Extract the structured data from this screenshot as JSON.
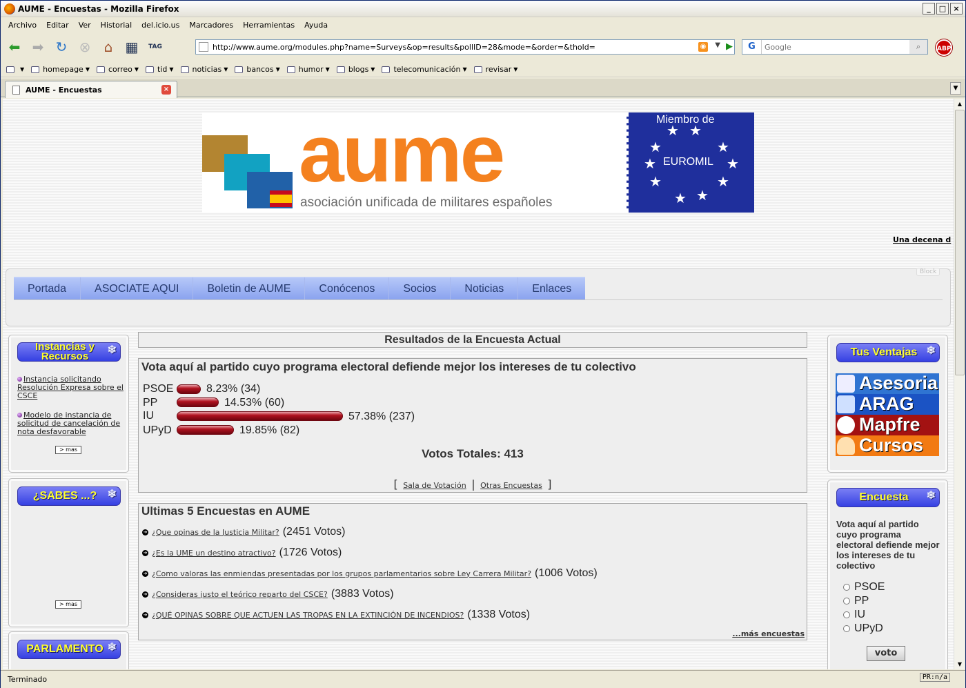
{
  "window": {
    "title": "AUME - Encuestas - Mozilla Firefox"
  },
  "menu": [
    "Archivo",
    "Editar",
    "Ver",
    "Historial",
    "del.icio.us",
    "Marcadores",
    "Herramientas",
    "Ayuda"
  ],
  "toolbar": {
    "url": "http://www.aume.org/modules.php?name=Surveys&op=results&pollID=28&mode=&order=&thold=",
    "search_placeholder": "Google",
    "tag_label": "TAG",
    "abp_label": "ABP"
  },
  "bookmarks": [
    "homepage",
    "correo",
    "tid",
    "noticias",
    "bancos",
    "humor",
    "blogs",
    "telecomunicación",
    "revisar"
  ],
  "tab": {
    "title": "AUME - Encuestas"
  },
  "status": {
    "text": "Terminado",
    "right": "PR:n/a"
  },
  "banner": {
    "word": "aume",
    "subtitle": "asociación unificada de militares españoles",
    "member": "Miembro de",
    "euromil": "EUROMIL",
    "marquee": "Una decena d"
  },
  "nav": {
    "block_tag": "Block",
    "items": [
      "Portada",
      "ASOCIATE AQUI",
      "Boletin de AUME",
      "Conócenos",
      "Socios",
      "Noticias",
      "Enlaces"
    ]
  },
  "left": {
    "box1": {
      "title": "Instancias y Recursos",
      "links": [
        "Instancia solicitando Resolución Expresa sobre el CSCE",
        "Modelo de instancia de solicitud de cancelación de nota desfavorable"
      ],
      "more": "> mas"
    },
    "box2": {
      "title": "¿SABES ...?",
      "more": "> mas"
    },
    "box3": {
      "title": "PARLAMENTO"
    }
  },
  "center": {
    "header": "Resultados de la Encuesta Actual",
    "question": "Vota aquí al partido cuyo programa electoral defiende mejor los intereses de tu colectivo",
    "results": [
      {
        "party": "PSOE",
        "text": "8.23% (34)"
      },
      {
        "party": "PP",
        "text": "14.53% (60)"
      },
      {
        "party": "IU",
        "text": "57.38% (237)"
      },
      {
        "party": "UPyD",
        "text": "19.85% (82)"
      }
    ],
    "total": "Votos Totales: 413",
    "links": {
      "open": "[",
      "sala": "Sala de Votación",
      "sep": "|",
      "otras": "Otras Encuestas",
      "close": "]"
    },
    "last_title": "Ultimas 5 Encuestas en AUME",
    "last": [
      {
        "q": "¿Que opinas de la Justicia Militar?",
        "v": "(2451 Votos)"
      },
      {
        "q": "¿Es la UME un destino atractivo?",
        "v": "(1726 Votos)"
      },
      {
        "q": "¿Como valoras las enmiendas presentadas por los grupos parlamentarios sobre Ley Carrera Militar?",
        "v": "(1006 Votos)"
      },
      {
        "q": "¿Consideras justo el teórico reparto del CSCE?",
        "v": "(3883 Votos)"
      },
      {
        "q": "¿QUÉ OPINAS SOBRE QUE ACTUEN LAS TROPAS EN LA EXTINCIÓN DE INCENDIOS?",
        "v": "(1338 Votos)"
      }
    ],
    "more": "...más encuestas"
  },
  "right": {
    "box1": {
      "title": "Tus Ventajas",
      "promos": [
        "Asesoria",
        "ARAG",
        "Mapfre",
        "Cursos"
      ]
    },
    "box2": {
      "title": "Encuesta",
      "question": "Vota aquí al partido cuyo programa electoral defiende mejor los intereses de tu colectivo",
      "options": [
        "PSOE",
        "PP",
        "IU",
        "UPyD"
      ],
      "button": "voto"
    }
  }
}
